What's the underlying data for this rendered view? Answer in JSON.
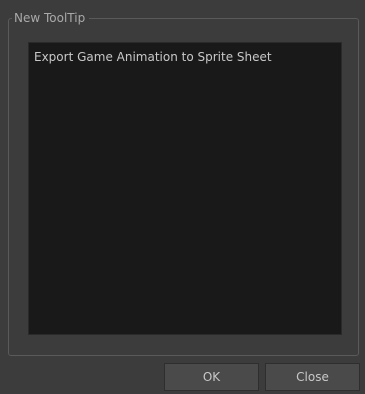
{
  "groupbox": {
    "title": "New ToolTip"
  },
  "tooltip_text": "Export Game Animation to Sprite Sheet",
  "buttons": {
    "ok_label": "OK",
    "close_label": "Close"
  }
}
